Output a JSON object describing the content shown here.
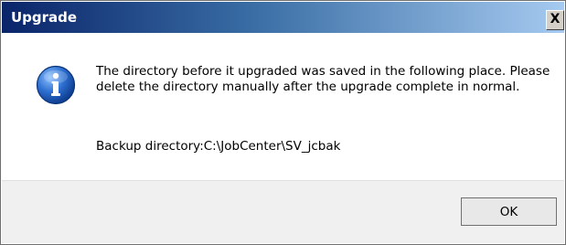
{
  "dialog": {
    "title": "Upgrade",
    "close_label": "X",
    "message": "The directory before it upgraded was saved in the following place. Please delete the directory manually after the upgrade complete in normal.",
    "backup_text": "Backup directory:C:\\JobCenter\\SV_jcbak",
    "icon": "info-icon",
    "ok_label": "OK"
  },
  "colors": {
    "titlebar_start": "#0a246a",
    "titlebar_end": "#a6caf0",
    "footer_bg": "#f0f0f0",
    "icon_blue": "#1f63c6"
  }
}
